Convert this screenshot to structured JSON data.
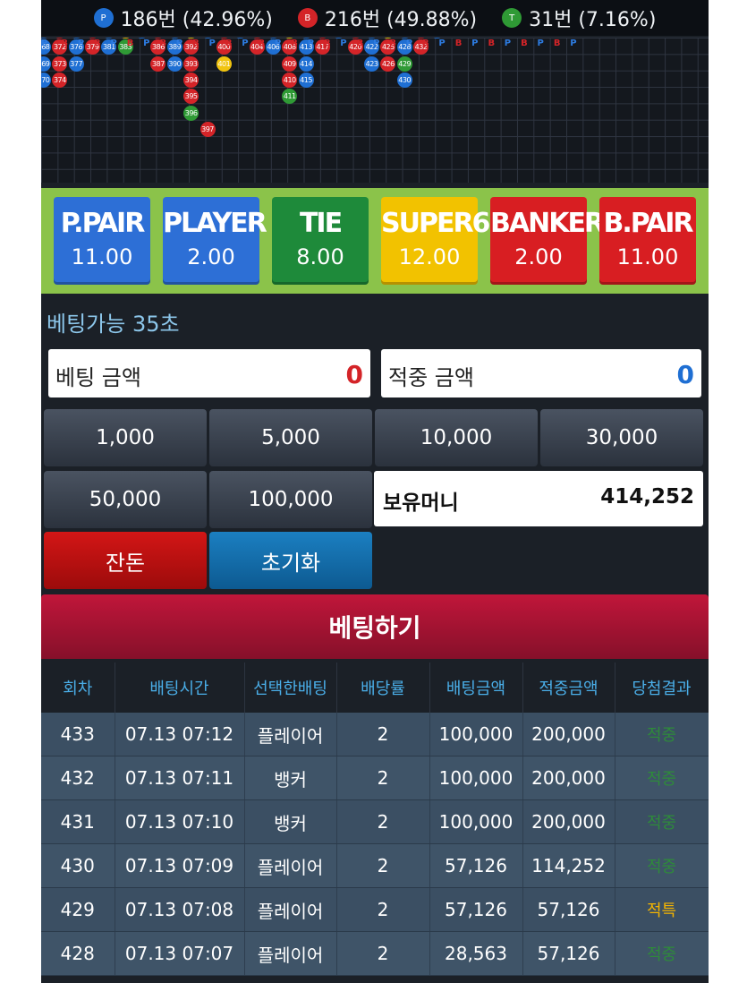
{
  "stats": [
    {
      "badge": "P",
      "color": "#1f6fd3",
      "text": "186번 (42.96%)"
    },
    {
      "badge": "B",
      "color": "#d42428",
      "text": "216번 (49.88%)"
    },
    {
      "badge": "T",
      "color": "#2f9a35",
      "text": "31번 (7.16%)"
    }
  ],
  "roadmap": {
    "headers": [
      "P",
      "B",
      "P",
      "B",
      "P",
      "B",
      "P",
      "B",
      "P",
      "B",
      "P",
      "B",
      "P",
      "B",
      "P",
      "B",
      "P",
      "B",
      "P",
      "B",
      "P",
      "B",
      "P",
      "B",
      "P",
      "B",
      "P",
      "B",
      "P",
      "B",
      "P",
      "B",
      "P"
    ],
    "columns": [
      [
        {
          "n": "367",
          "t": "P"
        },
        {
          "n": "368",
          "t": "P"
        },
        {
          "n": "369",
          "t": "P"
        },
        {
          "n": "370",
          "t": "P"
        }
      ],
      [
        {
          "n": "371",
          "t": "B"
        },
        {
          "n": "372",
          "t": "B"
        },
        {
          "n": "373",
          "t": "B"
        },
        {
          "n": "374",
          "t": "B"
        }
      ],
      [
        {
          "n": "375",
          "t": "P"
        },
        {
          "n": "376",
          "t": "P"
        },
        {
          "n": "377",
          "t": "P"
        }
      ],
      [
        {
          "n": "378",
          "t": "B"
        },
        {
          "n": "379",
          "t": "B"
        }
      ],
      [
        {
          "n": "380",
          "t": "P"
        },
        {
          "n": "381",
          "t": "P"
        }
      ],
      [
        {
          "n": "382",
          "t": "S"
        },
        {
          "n": "383",
          "t": "T"
        }
      ],
      [
        {
          "n": "384",
          "t": "P"
        }
      ],
      [
        {
          "n": "385",
          "t": "B"
        },
        {
          "n": "386",
          "t": "B"
        },
        {
          "n": "387",
          "t": "B"
        }
      ],
      [
        {
          "n": "388",
          "t": "P"
        },
        {
          "n": "389",
          "t": "P"
        },
        {
          "n": "390",
          "t": "P"
        }
      ],
      [
        {
          "n": "391",
          "t": "S"
        },
        {
          "n": "392",
          "t": "B"
        },
        {
          "n": "393",
          "t": "B"
        },
        {
          "n": "394",
          "t": "B"
        },
        {
          "n": "395",
          "t": "B"
        },
        {
          "n": "396",
          "t": "T"
        }
      ],
      [
        {
          "n": "398",
          "t": "P"
        }
      ],
      [
        {
          "n": "399",
          "t": "B"
        },
        {
          "n": "400",
          "t": "B"
        },
        {
          "n": "401",
          "t": "S"
        }
      ],
      [
        {
          "n": "402",
          "t": "P"
        }
      ],
      [
        {
          "n": "403",
          "t": "B"
        },
        {
          "n": "404",
          "t": "B"
        }
      ],
      [
        {
          "n": "405",
          "t": "P"
        },
        {
          "n": "406",
          "t": "P"
        }
      ],
      [
        {
          "n": "407",
          "t": "S"
        },
        {
          "n": "408",
          "t": "B"
        },
        {
          "n": "409",
          "t": "B"
        },
        {
          "n": "410",
          "t": "B"
        },
        {
          "n": "411",
          "t": "T"
        }
      ],
      [
        {
          "n": "412",
          "t": "P"
        },
        {
          "n": "413",
          "t": "P"
        },
        {
          "n": "414",
          "t": "P"
        },
        {
          "n": "415",
          "t": "P"
        }
      ],
      [
        {
          "n": "416",
          "t": "B"
        },
        {
          "n": "417",
          "t": "B"
        }
      ],
      [
        {
          "n": "418",
          "t": "P"
        }
      ],
      [
        {
          "n": "419",
          "t": "B"
        },
        {
          "n": "420",
          "t": "B"
        }
      ],
      [
        {
          "n": "421",
          "t": "P"
        },
        {
          "n": "422",
          "t": "P"
        },
        {
          "n": "423",
          "t": "P"
        }
      ],
      [
        {
          "n": "424",
          "t": "S"
        },
        {
          "n": "425",
          "t": "B"
        },
        {
          "n": "426",
          "t": "B"
        }
      ],
      [
        {
          "n": "427",
          "t": "P"
        },
        {
          "n": "428",
          "t": "P"
        },
        {
          "n": "429",
          "t": "T"
        },
        {
          "n": "430",
          "t": "P"
        }
      ],
      [
        {
          "n": "431",
          "t": "B"
        },
        {
          "n": "432",
          "t": "B"
        }
      ],
      [
        {
          "n": "433",
          "t": "P"
        }
      ]
    ],
    "extra": [
      {
        "n": "397",
        "t": "B"
      }
    ]
  },
  "bets": [
    {
      "label": "P.PAIR",
      "odds": "11.00",
      "color": "#2d6fd6"
    },
    {
      "label": "PLAYER",
      "odds": "2.00",
      "color": "#2d6fd6"
    },
    {
      "label": "TIE",
      "odds": "8.00",
      "color": "#1e8a3a"
    },
    {
      "label": "SUPER6",
      "odds": "12.00",
      "color": "#f2c200"
    },
    {
      "label": "BANKER",
      "odds": "2.00",
      "color": "#d81e22"
    },
    {
      "label": "B.PAIR",
      "odds": "11.00",
      "color": "#d81e22"
    }
  ],
  "timer": "베팅가능 35초",
  "bet_amount": {
    "label": "베팅 금액",
    "value": "0",
    "color": "#d42428"
  },
  "win_amount": {
    "label": "적중 금액",
    "value": "0",
    "color": "#1f6fd3"
  },
  "chips": [
    "1,000",
    "5,000",
    "10,000",
    "30,000",
    "50,000",
    "100,000"
  ],
  "balance": {
    "label": "보유머니",
    "value": "414,252"
  },
  "actions": {
    "change": "잔돈",
    "reset": "초기화"
  },
  "place_bet": "베팅하기",
  "history": {
    "headers": [
      "회차",
      "배팅시간",
      "선택한배팅",
      "배당률",
      "배팅금액",
      "적중금액",
      "당첨결과"
    ],
    "rows": [
      [
        "433",
        "07.13 07:12",
        "플레이어",
        "2",
        "100,000",
        "200,000",
        "적중"
      ],
      [
        "432",
        "07.13 07:11",
        "뱅커",
        "2",
        "100,000",
        "200,000",
        "적중"
      ],
      [
        "431",
        "07.13 07:10",
        "뱅커",
        "2",
        "100,000",
        "200,000",
        "적중"
      ],
      [
        "430",
        "07.13 07:09",
        "플레이어",
        "2",
        "57,126",
        "114,252",
        "적중"
      ],
      [
        "429",
        "07.13 07:08",
        "플레이어",
        "2",
        "57,126",
        "57,126",
        "적특"
      ],
      [
        "428",
        "07.13 07:07",
        "플레이어",
        "2",
        "28,563",
        "57,126",
        "적중"
      ]
    ]
  }
}
